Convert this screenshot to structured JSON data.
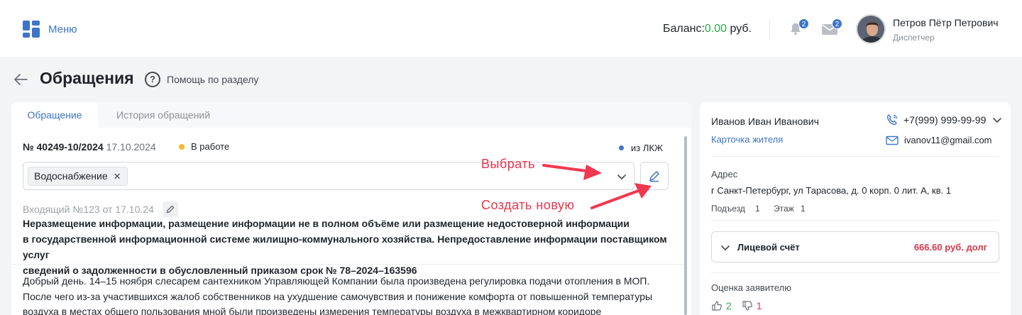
{
  "header": {
    "menu_label": "Меню",
    "balance_label": "Баланс:",
    "balance_value": "0.00",
    "balance_currency": " руб.",
    "notifications_count": "2",
    "messages_count": "2",
    "user_name": "Петров Пётр Петрович",
    "user_role": "Диспетчер"
  },
  "page": {
    "title": "Обращения",
    "help_label": "Помощь по разделу"
  },
  "tabs": [
    {
      "label": "Обращение"
    },
    {
      "label": "История обращений"
    }
  ],
  "ticket": {
    "number": "№ 40249-10/2024",
    "date": "17.10.2024",
    "status": "В работе",
    "source": "из ЛКЖ",
    "category_chip": "Водоснабжение",
    "incoming": "Входящий №123 от 17.10.24",
    "subject_lines": [
      "Неразмещение информации, размещение информации не в полном объёме или размещение недостоверной информации",
      "в государственной информационной системе жилищно-коммунального хозяйства. Непредоставление информации поставщиком услуг",
      "сведений о задолженности в обусловленный приказом срок № 78–2024–163596"
    ],
    "body_lines": [
      "Добрый день. 14–15 ноября слесарем сантехником Управляющей Компании была произведена регулировка подачи отопления в МОП.",
      "После чего из-за участившихся жалоб собственников на ухудшение самочувствия и понижение комфорта от повышенной температуры",
      "воздуха в местах общего пользования мной были произведены измерения температуры воздуха в межквартирном коридоре"
    ]
  },
  "annotations": {
    "choose": "Выбрать",
    "create": "Создать  новую"
  },
  "resident": {
    "name": "Иванов Иван Иванович",
    "card_link": "Карточка жителя",
    "phone": "+7(999) 999-99-99",
    "email": "ivanov11@gmail.com",
    "address_label": "Адрес",
    "address": "г Санкт-Петербург, ул Тарасова, д. 0 корп. 0 лит. А, кв. 1",
    "entrance_label": "Подъезд",
    "entrance": "1",
    "floor_label": "Этаж",
    "floor": "1",
    "account_label": "Лицевой счёт",
    "account_debt": "666.60 руб. долг",
    "rating_label": "Оценка заявителю",
    "likes": "2",
    "dislikes": "1"
  },
  "colors": {
    "accent": "#3d74c9",
    "balance": "#2fa84f",
    "status_dot": "#f5b82e",
    "source_dot": "#3d74c9",
    "debt": "#d6384b",
    "annotation": "#e8334a"
  }
}
